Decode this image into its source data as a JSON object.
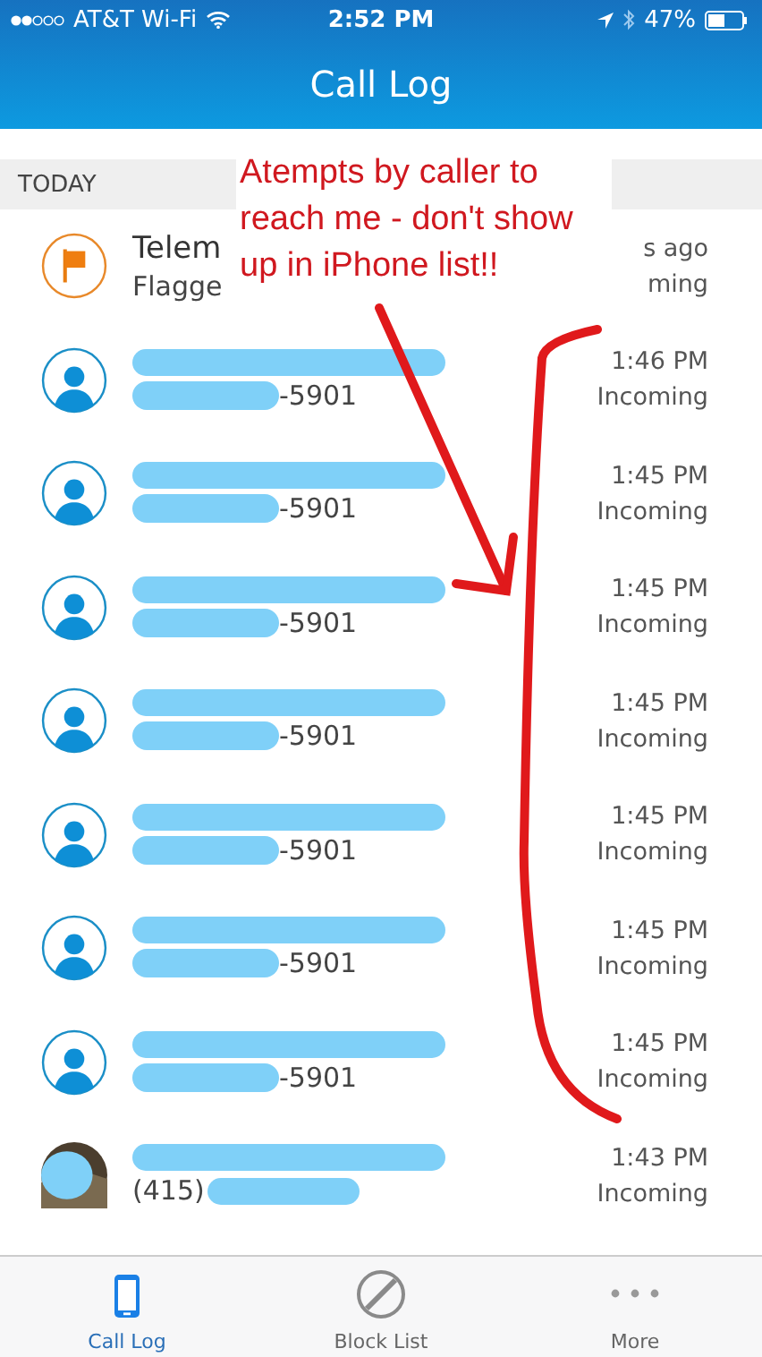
{
  "status_bar": {
    "carrier": "AT&T Wi-Fi",
    "time": "2:52 PM",
    "battery": "47%"
  },
  "header": {
    "title": "Call Log"
  },
  "section": "TODAY",
  "rows": [
    {
      "kind": "flagged",
      "name": "Telem",
      "number": "Flagge",
      "time": "s ago",
      "direction": "ming"
    },
    {
      "kind": "contact",
      "number": "-5901",
      "time": "1:46 PM",
      "direction": "Incoming"
    },
    {
      "kind": "contact",
      "number": "-5901",
      "time": "1:45 PM",
      "direction": "Incoming"
    },
    {
      "kind": "contact",
      "number": "-5901",
      "time": "1:45 PM",
      "direction": "Incoming"
    },
    {
      "kind": "contact",
      "number": "-5901",
      "time": "1:45 PM",
      "direction": "Incoming"
    },
    {
      "kind": "contact",
      "number": "-5901",
      "time": "1:45 PM",
      "direction": "Incoming"
    },
    {
      "kind": "contact",
      "number": "-5901",
      "time": "1:45 PM",
      "direction": "Incoming"
    },
    {
      "kind": "contact",
      "number": "-5901",
      "time": "1:45 PM",
      "direction": "Incoming"
    },
    {
      "number": "(415)",
      "time": "1:43 PM",
      "direction": "Incoming"
    }
  ],
  "annotation": {
    "text": "Atempts by caller to reach me - don't show up in iPhone list!!"
  },
  "tabs": [
    {
      "label": "Call Log",
      "selected": true
    },
    {
      "label": "Block List",
      "selected": false
    },
    {
      "label": "More",
      "selected": false
    }
  ]
}
